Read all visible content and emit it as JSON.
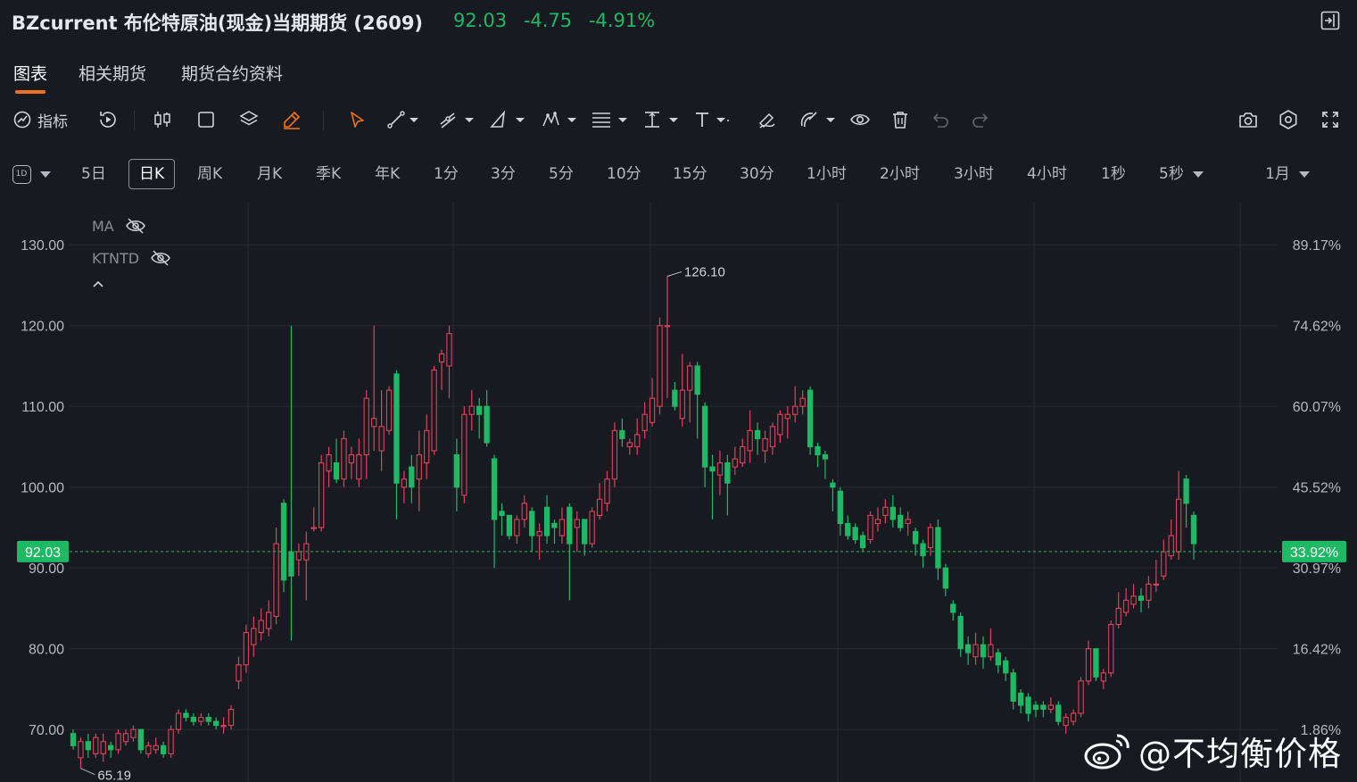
{
  "header": {
    "title": "BZcurrent 布伦特原油(现金)当期期货 (2609)",
    "price": "92.03",
    "change": "-4.75",
    "change_pct": "-4.91%"
  },
  "tabs": [
    {
      "label": "图表",
      "active": true
    },
    {
      "label": "相关期货",
      "active": false
    },
    {
      "label": "期货合约资料",
      "active": false
    }
  ],
  "toolbar": {
    "indicator_label": "指标",
    "icons": [
      "indicator-icon",
      "replay-icon",
      "candle-type-icon",
      "rectangle-icon",
      "layers-icon",
      "pencil-icon",
      "cursor-icon",
      "trend-line-icon",
      "multi-line-icon",
      "triangle-icon",
      "pattern-icon",
      "fib-icon",
      "measure-icon",
      "text-icon",
      "brush-icon",
      "magnet-icon",
      "eye-icon",
      "trash-icon",
      "undo-icon",
      "redo-icon",
      "camera-icon",
      "settings-icon",
      "fullscreen-icon"
    ]
  },
  "periods": {
    "badge": "1D",
    "items": [
      "5日",
      "日K",
      "周K",
      "月K",
      "季K",
      "年K",
      "1分",
      "3分",
      "5分",
      "10分",
      "15分",
      "30分",
      "1小时",
      "2小时",
      "3小时",
      "4小时",
      "1秒",
      "5秒"
    ],
    "active": "日K",
    "range": "1月"
  },
  "indicators": [
    "MA",
    "KTNTD"
  ],
  "chart_data": {
    "type": "candlestick",
    "y_left_ticks": [
      "130.00",
      "120.00",
      "110.00",
      "100.00",
      "90.00",
      "80.00",
      "70.00"
    ],
    "y_right_ticks": [
      "89.17%",
      "74.62%",
      "60.07%",
      "45.52%",
      "30.97%",
      "16.42%",
      "1.86%"
    ],
    "ylim": [
      63.5,
      134.0
    ],
    "current_price_label": "92.03",
    "current_pct_label": "33.92%",
    "high_label": "126.10",
    "low_label": "65.19",
    "colors": {
      "up": "#e0415a",
      "down": "#1fb964",
      "background": "#181a21",
      "grid": "#262932"
    },
    "candles": [
      [
        69.5,
        68.0,
        70.0,
        67.5
      ],
      [
        66.5,
        68.5,
        69.0,
        65.19
      ],
      [
        68.5,
        67.5,
        69.5,
        66.5
      ],
      [
        67.0,
        69.0,
        69.5,
        66.5
      ],
      [
        67.0,
        68.5,
        69.5,
        66.0
      ],
      [
        68.0,
        67.5,
        68.5,
        66.5
      ],
      [
        67.5,
        69.5,
        70.0,
        67.0
      ],
      [
        68.5,
        69.5,
        70.0,
        68.0
      ],
      [
        69.0,
        70.0,
        70.5,
        68.5
      ],
      [
        70.0,
        67.5,
        70.0,
        67.0
      ],
      [
        67.0,
        68.0,
        68.5,
        66.5
      ],
      [
        67.5,
        68.0,
        69.0,
        67.0
      ],
      [
        68.0,
        67.0,
        68.5,
        66.5
      ],
      [
        67.0,
        70.0,
        70.5,
        66.5
      ],
      [
        70.0,
        72.0,
        72.5,
        69.5
      ],
      [
        72.0,
        71.5,
        72.5,
        71.0
      ],
      [
        71.5,
        71.0,
        72.0,
        70.5
      ],
      [
        71.0,
        71.5,
        72.0,
        70.5
      ],
      [
        71.5,
        71.0,
        72.0,
        70.5
      ],
      [
        71.0,
        70.5,
        71.5,
        70.0
      ],
      [
        70.5,
        70.5,
        71.5,
        69.5
      ],
      [
        70.5,
        72.5,
        73.0,
        70.0
      ],
      [
        76.0,
        78.0,
        79.0,
        75.0
      ],
      [
        78.0,
        82.0,
        83.0,
        77.0
      ],
      [
        80.5,
        82.5,
        84.0,
        79.0
      ],
      [
        82.0,
        83.5,
        85.0,
        81.0
      ],
      [
        82.5,
        84.5,
        86.0,
        81.5
      ],
      [
        84.0,
        93.0,
        95.0,
        83.0
      ],
      [
        98.0,
        88.5,
        98.5,
        87.0
      ],
      [
        92.0,
        89.0,
        120.0,
        81.0
      ],
      [
        91.0,
        92.0,
        93.0,
        89.0
      ],
      [
        91.0,
        93.0,
        94.5,
        86.0
      ],
      [
        95.0,
        95.0,
        97.5,
        94.5
      ],
      [
        95.0,
        103.0,
        104.0,
        94.5
      ],
      [
        102.0,
        104.0,
        105.0,
        100.0
      ],
      [
        103.0,
        101.0,
        106.0,
        100.5
      ],
      [
        101.0,
        106.0,
        107.0,
        100.0
      ],
      [
        103.0,
        104.0,
        105.0,
        101.0
      ],
      [
        101.0,
        104.0,
        106.0,
        100.0
      ],
      [
        104.0,
        111.0,
        112.0,
        101.0
      ],
      [
        107.5,
        108.5,
        120.0,
        104.5
      ],
      [
        104.5,
        107.5,
        112.0,
        102.0
      ],
      [
        107.0,
        112.0,
        112.5,
        106.5
      ],
      [
        114.0,
        100.5,
        114.5,
        96.0
      ],
      [
        100.0,
        101.0,
        102.0,
        98.0
      ],
      [
        102.5,
        100.0,
        104.0,
        98.0
      ],
      [
        101.0,
        104.0,
        107.0,
        97.0
      ],
      [
        103.0,
        107.0,
        109.0,
        101.0
      ],
      [
        104.5,
        114.5,
        115.0,
        104.0
      ],
      [
        115.5,
        116.5,
        117.0,
        112.0
      ],
      [
        115.0,
        119.0,
        120.0,
        111.0
      ],
      [
        104.0,
        100.0,
        106.0,
        97.0
      ],
      [
        99.0,
        109.0,
        110.0,
        98.0
      ],
      [
        109.0,
        110.0,
        112.0,
        107.0
      ],
      [
        110.0,
        109.0,
        111.0,
        106.0
      ],
      [
        110.0,
        105.5,
        112.0,
        105.0
      ],
      [
        103.5,
        96.0,
        104.0,
        90.0
      ],
      [
        97.0,
        96.5,
        98.0,
        94.0
      ],
      [
        96.5,
        94.0,
        96.5,
        93.5
      ],
      [
        94.0,
        96.0,
        96.5,
        93.0
      ],
      [
        96.0,
        98.0,
        99.0,
        95.0
      ],
      [
        97.0,
        94.0,
        97.5,
        92.0
      ],
      [
        94.0,
        94.5,
        95.5,
        91.0
      ],
      [
        97.5,
        94.0,
        99.0,
        93.0
      ],
      [
        95.5,
        95.0,
        96.0,
        93.0
      ],
      [
        94.0,
        96.0,
        97.5,
        93.0
      ],
      [
        97.5,
        93.0,
        98.0,
        86.0
      ],
      [
        95.0,
        96.0,
        97.0,
        92.0
      ],
      [
        96.0,
        93.0,
        96.0,
        91.5
      ],
      [
        93.0,
        97.0,
        97.5,
        92.5
      ],
      [
        96.5,
        98.5,
        100.5,
        96.0
      ],
      [
        98.0,
        101.0,
        102.0,
        97.0
      ],
      [
        101.0,
        107.0,
        108.0,
        100.0
      ],
      [
        107.0,
        106.0,
        108.5,
        105.0
      ],
      [
        105.0,
        105.5,
        106.0,
        104.0
      ],
      [
        105.0,
        106.5,
        108.5,
        104.0
      ],
      [
        107.0,
        109.0,
        110.5,
        106.0
      ],
      [
        108.0,
        111.0,
        113.5,
        107.5
      ],
      [
        110.0,
        120.0,
        121.0,
        109.0
      ],
      [
        120.0,
        120.0,
        126.1,
        111.0
      ],
      [
        112.0,
        110.0,
        113.0,
        109.5
      ],
      [
        108.5,
        112.0,
        116.5,
        107.5
      ],
      [
        112.0,
        115.0,
        115.5,
        108.0
      ],
      [
        115.0,
        111.5,
        115.5,
        106.0
      ],
      [
        110.0,
        102.5,
        110.5,
        100.0
      ],
      [
        102.5,
        102.0,
        104.0,
        96.0
      ],
      [
        101.5,
        103.0,
        104.5,
        99.0
      ],
      [
        103.0,
        100.5,
        104.0,
        96.5
      ],
      [
        102.5,
        103.5,
        105.0,
        101.5
      ],
      [
        103.0,
        105.0,
        106.0,
        102.5
      ],
      [
        104.5,
        107.0,
        109.5,
        103.0
      ],
      [
        107.0,
        106.0,
        108.0,
        104.0
      ],
      [
        104.5,
        106.0,
        107.0,
        103.0
      ],
      [
        105.0,
        107.5,
        108.0,
        104.0
      ],
      [
        106.5,
        109.0,
        109.5,
        105.5
      ],
      [
        108.5,
        109.0,
        110.0,
        106.0
      ],
      [
        109.0,
        110.0,
        112.5,
        108.0
      ],
      [
        110.0,
        111.0,
        112.0,
        109.0
      ],
      [
        112.0,
        105.0,
        112.5,
        104.0
      ],
      [
        105.0,
        104.0,
        105.5,
        102.5
      ],
      [
        104.0,
        103.5,
        104.5,
        101.0
      ],
      [
        100.5,
        100.0,
        101.0,
        97.0
      ],
      [
        99.5,
        95.5,
        100.0,
        94.0
      ],
      [
        95.5,
        94.0,
        96.5,
        93.5
      ],
      [
        95.0,
        93.5,
        95.5,
        93.0
      ],
      [
        94.0,
        92.5,
        94.5,
        92.0
      ],
      [
        93.5,
        96.5,
        97.0,
        93.0
      ],
      [
        95.5,
        96.0,
        97.5,
        94.5
      ],
      [
        96.5,
        97.5,
        98.5,
        95.5
      ],
      [
        97.5,
        96.0,
        99.0,
        95.0
      ],
      [
        96.5,
        95.0,
        97.5,
        94.5
      ],
      [
        95.5,
        96.0,
        97.0,
        94.0
      ],
      [
        94.5,
        93.0,
        95.0,
        91.5
      ],
      [
        93.0,
        91.5,
        93.5,
        90.0
      ],
      [
        92.5,
        95.0,
        95.5,
        91.5
      ],
      [
        95.0,
        90.0,
        96.0,
        88.5
      ],
      [
        90.0,
        87.5,
        90.5,
        86.5
      ],
      [
        85.5,
        84.5,
        86.0,
        83.5
      ],
      [
        84.0,
        80.0,
        84.5,
        79.0
      ],
      [
        80.5,
        79.5,
        81.5,
        78.0
      ],
      [
        79.0,
        80.5,
        82.0,
        78.0
      ],
      [
        80.5,
        79.0,
        81.5,
        77.5
      ],
      [
        79.0,
        80.5,
        82.5,
        78.5
      ],
      [
        79.5,
        78.0,
        80.0,
        77.0
      ],
      [
        78.5,
        77.0,
        79.0,
        76.0
      ],
      [
        77.0,
        73.5,
        77.5,
        72.5
      ],
      [
        74.5,
        73.0,
        75.0,
        72.0
      ],
      [
        74.0,
        72.0,
        74.5,
        71.0
      ],
      [
        73.0,
        72.5,
        73.5,
        71.5
      ],
      [
        73.0,
        72.5,
        73.5,
        71.5
      ],
      [
        72.5,
        73.0,
        74.0,
        72.0
      ],
      [
        73.0,
        71.0,
        73.5,
        70.5
      ],
      [
        70.5,
        71.5,
        72.0,
        69.5
      ],
      [
        71.0,
        72.0,
        72.5,
        70.5
      ],
      [
        72.0,
        76.0,
        76.5,
        71.5
      ],
      [
        76.0,
        80.0,
        81.0,
        75.5
      ],
      [
        80.0,
        76.5,
        80.0,
        76.0
      ],
      [
        76.0,
        77.0,
        77.5,
        75.0
      ],
      [
        77.0,
        83.0,
        83.5,
        76.5
      ],
      [
        83.0,
        85.0,
        87.0,
        82.5
      ],
      [
        84.5,
        86.0,
        87.5,
        84.0
      ],
      [
        85.5,
        86.5,
        88.0,
        85.0
      ],
      [
        86.5,
        86.0,
        87.5,
        84.5
      ],
      [
        86.0,
        88.0,
        89.0,
        85.0
      ],
      [
        88.0,
        88.0,
        91.0,
        87.0
      ],
      [
        89.0,
        92.0,
        93.5,
        88.5
      ],
      [
        91.5,
        94.0,
        96.0,
        91.0
      ],
      [
        92.0,
        98.5,
        102.0,
        91.0
      ],
      [
        101.0,
        98.0,
        101.5,
        95.0
      ],
      [
        96.5,
        93.0,
        97.0,
        91.0
      ]
    ]
  },
  "watermark": "@不均衡价格"
}
